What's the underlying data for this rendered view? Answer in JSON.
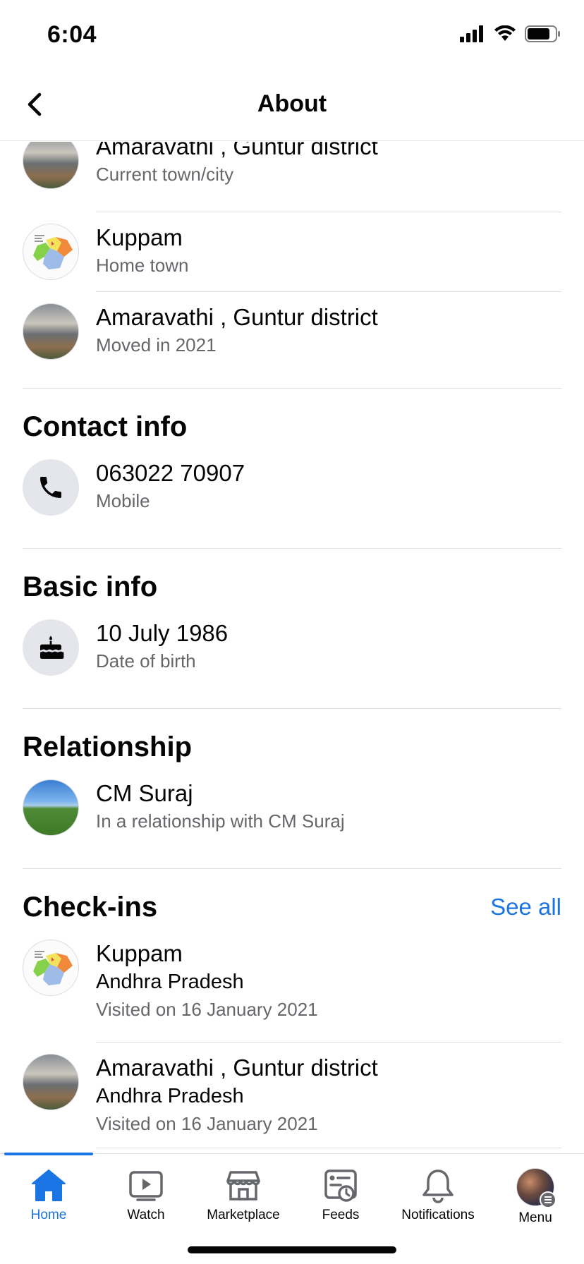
{
  "status_bar": {
    "time": "6:04"
  },
  "header": {
    "title": "About"
  },
  "places": [
    {
      "title": "Amaravathi , Guntur district",
      "subtitle": "Current town/city",
      "icon": "amaravathi-photo"
    },
    {
      "title": "Kuppam",
      "subtitle": "Home town",
      "icon": "kuppam-map"
    },
    {
      "title": "Amaravathi , Guntur district",
      "subtitle": "Moved in 2021",
      "icon": "amaravathi-photo"
    }
  ],
  "contact": {
    "heading": "Contact info",
    "phone": "063022 70907",
    "phone_type": "Mobile",
    "icon": "phone-icon"
  },
  "basic": {
    "heading": "Basic info",
    "dob": "10 July 1986",
    "dob_label": "Date of birth",
    "icon": "birthday-cake-icon"
  },
  "relationship": {
    "heading": "Relationship",
    "name": "CM Suraj",
    "status": "In a relationship with CM Suraj"
  },
  "checkins": {
    "heading": "Check-ins",
    "see_all": "See all",
    "items": [
      {
        "place": "Kuppam",
        "region": "Andhra Pradesh",
        "date": "Visited on 16 January 2021"
      },
      {
        "place": "Amaravathi , Guntur district",
        "region": "Andhra Pradesh",
        "date": "Visited on 16 January 2021"
      }
    ]
  },
  "tab_bar": {
    "tabs": [
      {
        "label": "Home",
        "icon": "home-icon",
        "active": true
      },
      {
        "label": "Watch",
        "icon": "watch-icon"
      },
      {
        "label": "Marketplace",
        "icon": "marketplace-icon"
      },
      {
        "label": "Feeds",
        "icon": "feeds-icon"
      },
      {
        "label": "Notifications",
        "icon": "bell-icon"
      },
      {
        "label": "Menu",
        "icon": "profile-avatar"
      }
    ]
  },
  "colors": {
    "accent": "#1b74e4",
    "secondary_text": "#65676b",
    "divider": "#dadde1"
  }
}
